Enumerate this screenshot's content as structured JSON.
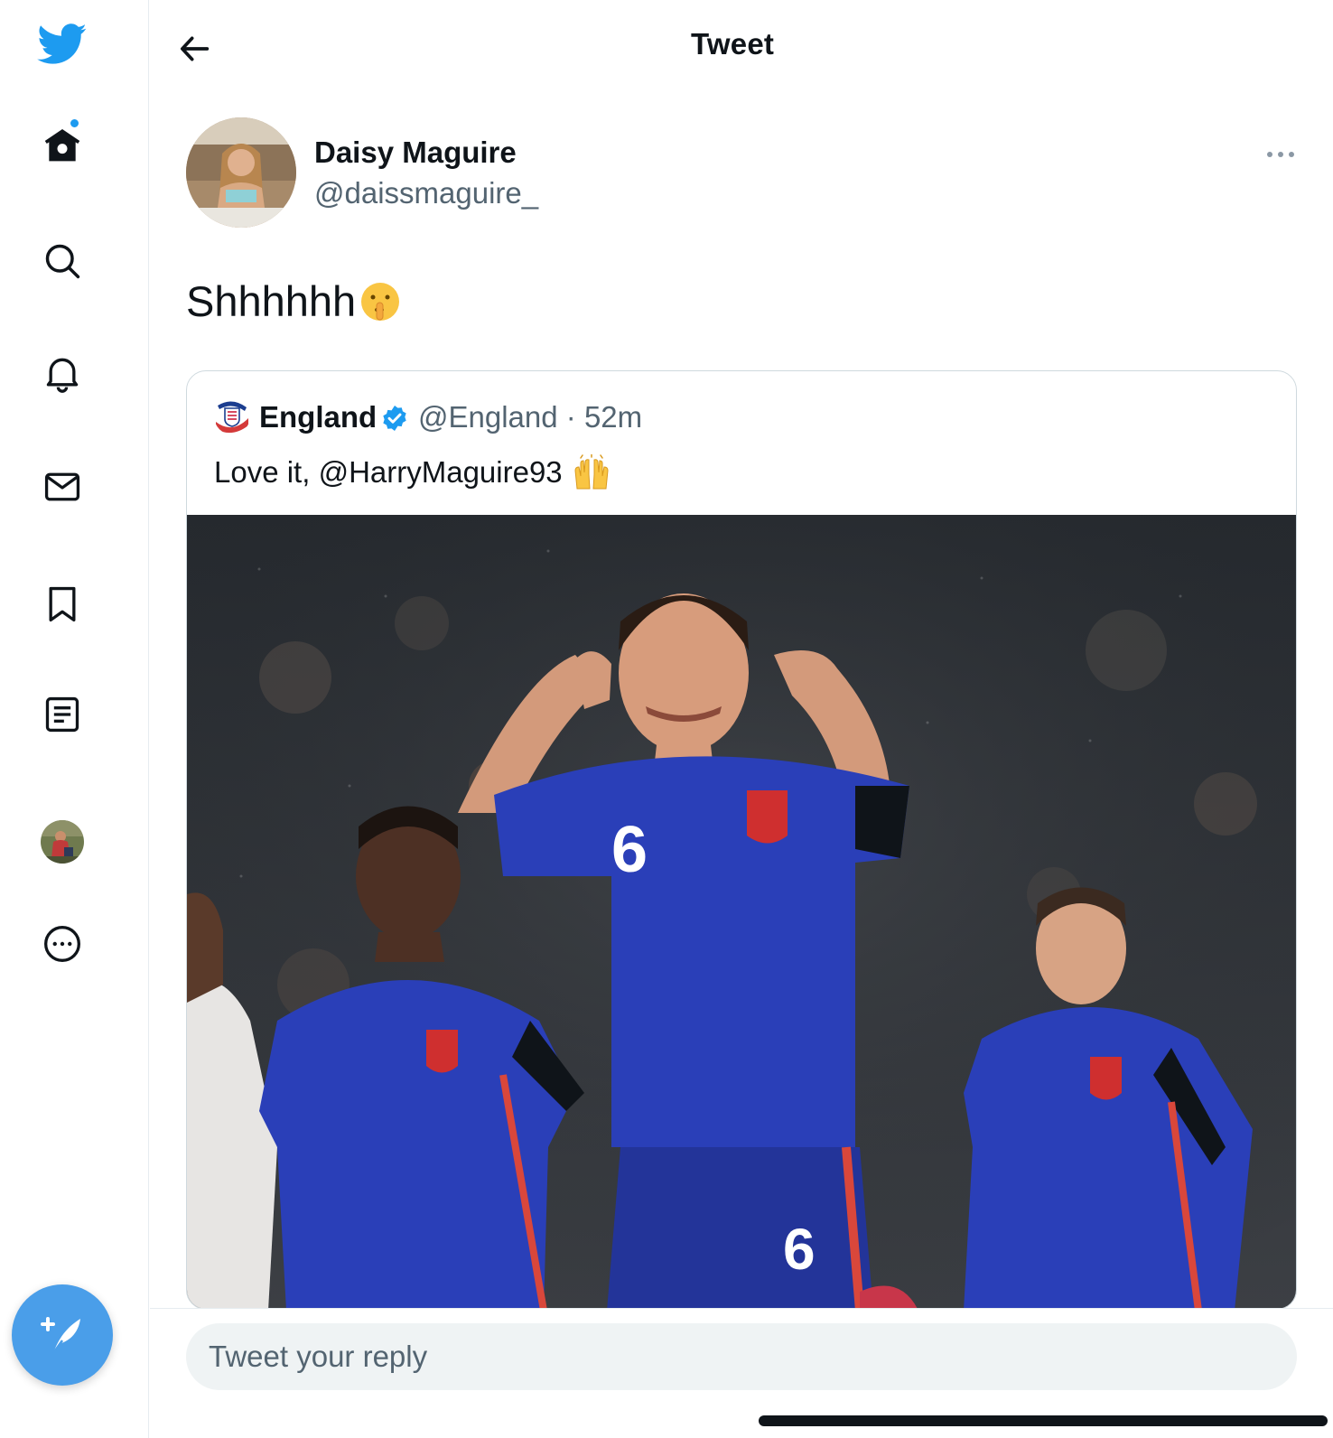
{
  "header": {
    "title": "Tweet"
  },
  "tweet": {
    "author_name": "Daisy Maguire",
    "author_handle": "@daissmaguire_",
    "text": "Shhhhhh",
    "text_emoji": "shushing-face"
  },
  "quoted_tweet": {
    "author_name": "England",
    "author_handle": "@England",
    "separator": "·",
    "time": "52m",
    "text": "Love it, @HarryMaguire93",
    "text_emoji": "raising-hands",
    "media_description": ""
  },
  "reply": {
    "placeholder": "Tweet your reply"
  },
  "colors": {
    "accent": "#1d9bf0",
    "compose": "#4a9ee9",
    "kit_blue": "#2a3fb8"
  },
  "sidebar": {
    "items": [
      {
        "icon": "twitter-logo-icon"
      },
      {
        "icon": "home-icon"
      },
      {
        "icon": "search-icon"
      },
      {
        "icon": "bell-icon"
      },
      {
        "icon": "mail-icon"
      },
      {
        "icon": "bookmark-icon"
      },
      {
        "icon": "lists-icon"
      },
      {
        "icon": "profile-avatar"
      },
      {
        "icon": "more-icon"
      }
    ]
  }
}
